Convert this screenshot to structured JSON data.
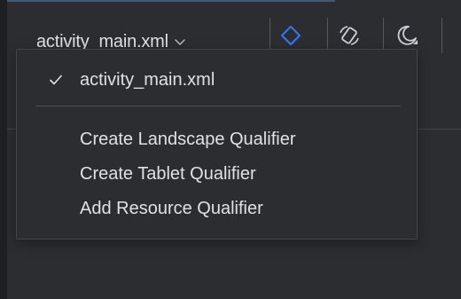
{
  "toolbar": {
    "file_selector_label": "activity_main.xml",
    "file_selector_icon": "chevron-down-icon",
    "icons": [
      "layers-icon",
      "rotate-device-icon",
      "night-mode-icon"
    ],
    "accent_color": "#3574f0"
  },
  "menu": {
    "current": {
      "label": "activity_main.xml",
      "checked": true
    },
    "actions": [
      {
        "label": "Create Landscape Qualifier"
      },
      {
        "label": "Create Tablet Qualifier"
      },
      {
        "label": "Add Resource Qualifier"
      }
    ]
  }
}
